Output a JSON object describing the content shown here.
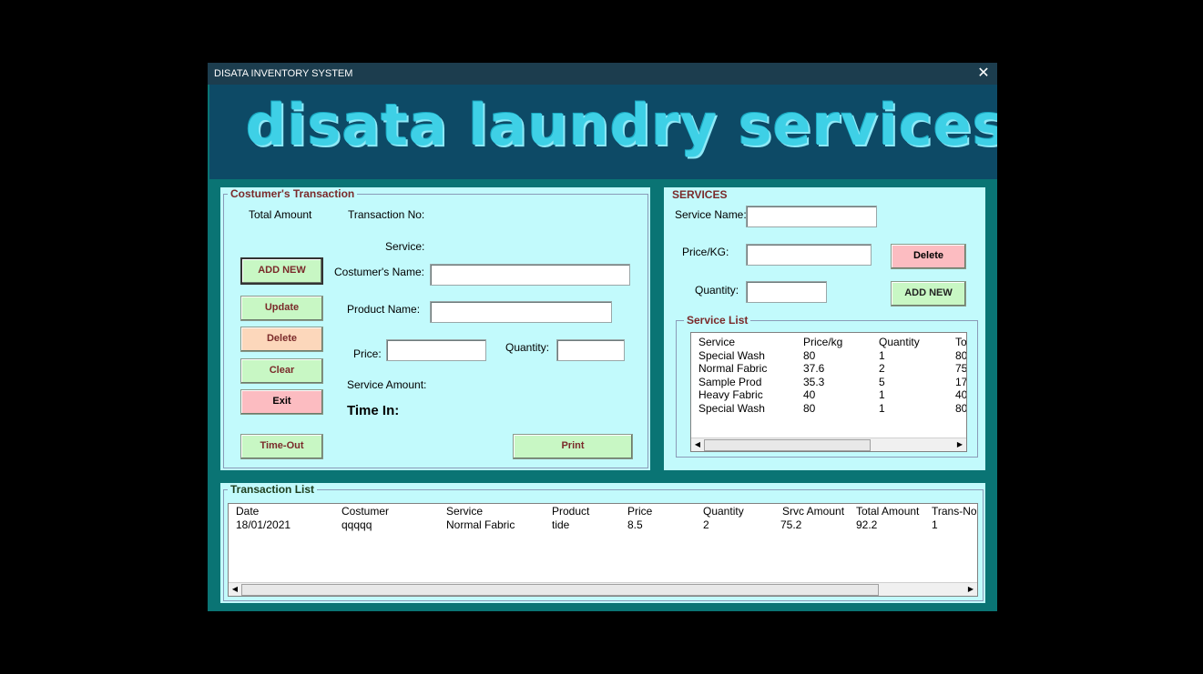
{
  "window": {
    "title": "DISATA INVENTORY SYSTEM",
    "close_glyph": "✕"
  },
  "banner": {
    "text": "disata laundry services"
  },
  "transaction": {
    "frame_title": "Costumer's Transaction",
    "total_amount_label": "Total Amount",
    "transaction_no_label": "Transaction No:",
    "service_label": "Service:",
    "customer_name_label": "Costumer's Name:",
    "customer_name_value": "",
    "product_name_label": "Product Name:",
    "product_name_value": "",
    "price_label": "Price:",
    "price_value": "",
    "quantity_label": "Quantity:",
    "quantity_value": "",
    "service_amount_label": "Service Amount:",
    "time_in_label": "Time In:",
    "buttons": {
      "add_new": "ADD NEW",
      "update": "Update",
      "delete": "Delete",
      "clear": "Clear",
      "exit": "Exit",
      "time_out": "Time-Out",
      "print": "Print"
    }
  },
  "services": {
    "title": "SERVICES",
    "service_name_label": "Service Name:",
    "service_name_value": "",
    "price_kg_label": "Price/KG:",
    "price_kg_value": "",
    "quantity_label": "Quantity:",
    "quantity_value": "",
    "delete_button": "Delete",
    "add_new_button": "ADD NEW",
    "list_title": "Service List",
    "columns": [
      "Service",
      "Price/kg",
      "Quantity",
      "To"
    ],
    "rows": [
      [
        "Special Wash",
        "80",
        "1",
        "80"
      ],
      [
        "Normal Fabric",
        "37.6",
        "2",
        "75"
      ],
      [
        "Sample Prod",
        "35.3",
        "5",
        "17"
      ],
      [
        "Heavy Fabric",
        "40",
        "1",
        "40"
      ],
      [
        "Special Wash",
        "80",
        "1",
        "80"
      ]
    ]
  },
  "transaction_list": {
    "title": "Transaction List",
    "columns": [
      "Date",
      "Costumer",
      "Service",
      "Product",
      "Price",
      "Quantity",
      "Srvc Amount",
      "Total Amount",
      "Trans-No."
    ],
    "rows": [
      [
        "18/01/2021",
        "qqqqq",
        "Normal Fabric",
        "tide",
        "8.5",
        "2",
        "75.2",
        "92.2",
        "1"
      ]
    ]
  },
  "colors": {
    "window_bg": "#0a7474",
    "panel_bg": "#c2fafc",
    "title_bar": "#1c3d4e",
    "banner_bg": "#0d4a66",
    "banner_text": "#3ed0e6",
    "button_green": "#c8f7c4",
    "button_peach": "#fcd7bb",
    "button_pink": "#fcbcc1",
    "label_maroon": "#7a2a2a"
  },
  "icons": {
    "close": "close-icon",
    "scroll_left": "chevron-left-icon",
    "scroll_right": "chevron-right-icon"
  }
}
